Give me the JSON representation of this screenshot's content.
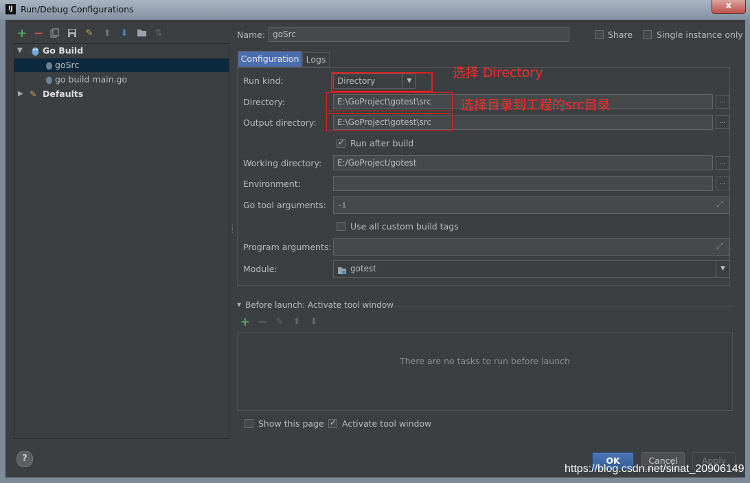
{
  "window": {
    "title": "Run/Debug Configurations",
    "app_icon": "IJ",
    "close_label": "x"
  },
  "toolbar": {
    "icons": [
      "add-icon",
      "remove-icon",
      "copy-icon",
      "save-icon",
      "wrench-icon",
      "move-up-icon",
      "move-down-icon",
      "folder-icon",
      "sort-icon"
    ]
  },
  "tree": {
    "go_build": {
      "label": "Go Build"
    },
    "items": [
      {
        "label": "goSrc"
      },
      {
        "label": "go build main.go"
      }
    ],
    "defaults": {
      "label": "Defaults"
    }
  },
  "header": {
    "name_label": "Name:",
    "name_value": "goSrc",
    "share_label": "Share",
    "single_instance_label": "Single instance only"
  },
  "tabs": [
    {
      "label": "Configuration",
      "active": true
    },
    {
      "label": "Logs",
      "active": false
    }
  ],
  "form": {
    "run_kind_label": "Run kind:",
    "run_kind_value": "Directory",
    "directory_label": "Directory:",
    "directory_value": "E:\\GoProject\\gotest\\src",
    "output_label": "Output directory:",
    "output_value": "E:\\GoProject\\gotest\\src",
    "run_after_build_label": "Run after build",
    "run_after_build_checked": true,
    "working_label": "Working directory:",
    "working_value": "E:/GoProject/gotest",
    "environment_label": "Environment:",
    "environment_value": "",
    "go_tool_label": "Go tool arguments:",
    "go_tool_value": "-i",
    "custom_tags_label": "Use all custom build tags",
    "custom_tags_checked": false,
    "program_args_label": "Program arguments:",
    "program_args_value": "",
    "module_label": "Module:",
    "module_value": "gotest",
    "browse_label": "..."
  },
  "annotations": {
    "a1": "选择 Directory",
    "a2": "选择目录到工程的src目录"
  },
  "before_launch": {
    "title": "Before launch: Activate tool window",
    "empty_text": "There are no tasks to run before launch"
  },
  "footer": {
    "show_page_label": "Show this page",
    "show_page_checked": false,
    "activate_label": "Activate tool window",
    "activate_checked": true,
    "help_label": "?"
  },
  "buttons": {
    "ok": "OK",
    "cancel": "Cancel",
    "apply": "Apply"
  },
  "watermark": "https://blog.csdn.net/sinat_20906149",
  "colors": {
    "red_annotation": "#ff2a2a",
    "selection": "#0d293e",
    "panel_bg": "#3c3f41"
  }
}
